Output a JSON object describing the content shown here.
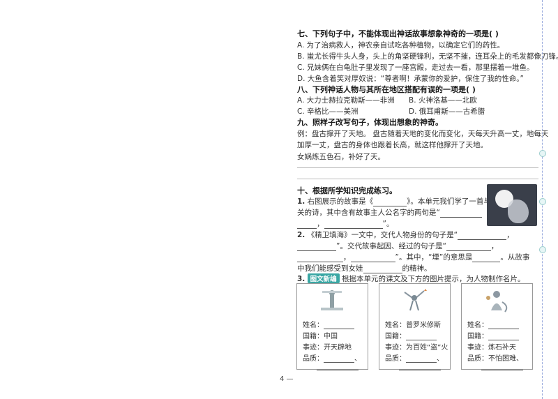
{
  "q7": {
    "title": "七、下列句子中，不能体现出神话故事想象神奇的一项是(        )",
    "options": [
      "A. 为了治病救人，神农亲自试吃各种植物，以确定它们的药性。",
      "B. 蚩尤长得牛头人身，头上的角坚硬锋利，无坚不摧，连耳朵上的毛发都像刀锋。",
      "C. 兄妹俩在白龟肚子里发现了一座宫殿，走过去一看，那里摆着一堆鱼。",
      "D. 大鱼含着笑对厚奴说：“尊者啊！承蒙你的爱护，保住了我的性命。”"
    ]
  },
  "q8": {
    "title": "八、下列神话人物与其所在地区搭配有误的一项是(        )",
    "a": "A. 大力士赫拉克勒斯——非洲",
    "b": "B. 火神洛基——北欧",
    "c": "C. 辛格比——美洲",
    "d": "D. 俄耳甫斯——古希腊"
  },
  "q9": {
    "title": "九、照样子改写句子，体现出想象的神奇。",
    "example_1": "例：盘古撑开了天地。      盘古随着天地的变化而变化，天每天升高一丈，地每天",
    "example_2": "加厚一丈，盘古的身体也跟着长高，就这样他撑开了天地。",
    "prompt": "女娲炼五色石，补好了天。"
  },
  "q10": {
    "title": "十、根据所学知识完成练习。",
    "i1_num": "1.",
    "i1_a": "右图展示的故事是《",
    "i1_b": "》。本单元我们学了一首与之有",
    "i1_c": "关的诗，其中含有故事主人公名字的两句是“",
    "i1_d": "，",
    "i1_e": "”。",
    "i2_num": "2.",
    "i2_a": "《精卫填海》一文中，交代人物身份的句子是“",
    "i2_b": "，",
    "i2_c": "”。交代故事起因、经过的句子是“",
    "i2_d": "，",
    "i2_e": "，",
    "i2_f": "”。其中，“堙”的意思是",
    "i2_g": "。从故事",
    "i2_h": "中我们能感受到女娃",
    "i2_i": "的精神。",
    "i3_num": "3.",
    "i3_badge": "图文新编",
    "i3_text": "根据本单元的课文及下方的图片提示，为人物制作名片。"
  },
  "cards": [
    {
      "name": "姓名：",
      "region": "国籍：中国",
      "deed": "事迹：开天辟地",
      "quality": "品质：",
      "sep": "、"
    },
    {
      "name": "姓名：普罗米修斯",
      "region": "国籍：",
      "deed": "事迹：为百姓“盗”火",
      "quality": "品质：",
      "sep": "、"
    },
    {
      "name": "姓名：",
      "region": "国籍：",
      "deed": "事迹：炼石补天",
      "quality": "品质：不怕困难、",
      "sep": ""
    }
  ],
  "page_number": "4  —"
}
